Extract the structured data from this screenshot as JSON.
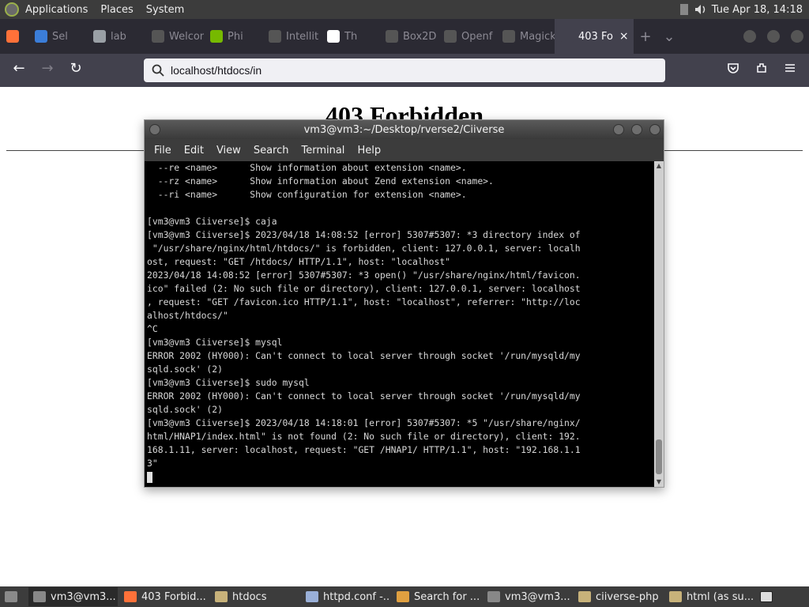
{
  "panel": {
    "menus": [
      "Applications",
      "Places",
      "System"
    ],
    "clock": "Tue Apr 18, 14:18"
  },
  "tabs": [
    {
      "label": "",
      "icon": "firefox-icon",
      "color": "#ff7139"
    },
    {
      "label": "Sel",
      "icon": "globe-icon",
      "color": "#3b7dd8"
    },
    {
      "label": "lab",
      "icon": "computer-icon",
      "color": "#9aa0a6"
    },
    {
      "label": "Welcom",
      "icon": "page-icon",
      "color": "#555555"
    },
    {
      "label": "Phi",
      "icon": "nvidia-icon",
      "color": "#76b900"
    },
    {
      "label": "Intellit",
      "icon": "page-icon",
      "color": "#555555"
    },
    {
      "label": "Th",
      "icon": "document-icon",
      "color": "#ffffff"
    },
    {
      "label": "Box2D",
      "icon": "page-icon",
      "color": "#555555"
    },
    {
      "label": "Openf",
      "icon": "page-icon",
      "color": "#555555"
    },
    {
      "label": "Magick",
      "icon": "page-icon",
      "color": "#555555"
    },
    {
      "label": "403 Fo",
      "icon": "page-icon",
      "color": "#42414d",
      "active": true
    }
  ],
  "tab_close": "×",
  "url": "localhost/htdocs/in",
  "page": {
    "title": "403 Forbidden"
  },
  "terminal": {
    "title": "vm3@vm3:~/Desktop/rverse2/Ciiverse",
    "menu": [
      "File",
      "Edit",
      "View",
      "Search",
      "Terminal",
      "Help"
    ],
    "lines": [
      "  --re <name>      Show information about extension <name>.",
      "  --rz <name>      Show information about Zend extension <name>.",
      "  --ri <name>      Show configuration for extension <name>.",
      "",
      "[vm3@vm3 Ciiverse]$ caja",
      "[vm3@vm3 Ciiverse]$ 2023/04/18 14:08:52 [error] 5307#5307: *3 directory index of",
      " \"/usr/share/nginx/html/htdocs/\" is forbidden, client: 127.0.0.1, server: localh",
      "ost, request: \"GET /htdocs/ HTTP/1.1\", host: \"localhost\"",
      "2023/04/18 14:08:52 [error] 5307#5307: *3 open() \"/usr/share/nginx/html/favicon.",
      "ico\" failed (2: No such file or directory), client: 127.0.0.1, server: localhost",
      ", request: \"GET /favicon.ico HTTP/1.1\", host: \"localhost\", referrer: \"http://loc",
      "alhost/htdocs/\"",
      "^C",
      "[vm3@vm3 Ciiverse]$ mysql",
      "ERROR 2002 (HY000): Can't connect to local server through socket '/run/mysqld/my",
      "sqld.sock' (2)",
      "[vm3@vm3 Ciiverse]$ sudo mysql",
      "ERROR 2002 (HY000): Can't connect to local server through socket '/run/mysqld/my",
      "sqld.sock' (2)",
      "[vm3@vm3 Ciiverse]$ 2023/04/18 14:18:01 [error] 5307#5307: *5 \"/usr/share/nginx/",
      "html/HNAP1/index.html\" is not found (2: No such file or directory), client: 192.",
      "168.1.11, server: localhost, request: \"GET /HNAP1/ HTTP/1.1\", host: \"192.168.1.1",
      "3\""
    ]
  },
  "taskbar": [
    {
      "label": "vm3@vm3...",
      "icon": "terminal-icon",
      "color": "#888888",
      "active": true
    },
    {
      "label": "403 Forbid...",
      "icon": "firefox-icon",
      "color": "#ff7139"
    },
    {
      "label": "htdocs",
      "icon": "folder-icon",
      "color": "#c8b27a"
    },
    {
      "label": "httpd.conf -...",
      "icon": "text-editor-icon",
      "color": "#9ab0d8"
    },
    {
      "label": "Search for ...",
      "icon": "search-tool-icon",
      "color": "#e0a040"
    },
    {
      "label": "vm3@vm3...",
      "icon": "terminal-icon",
      "color": "#888888"
    },
    {
      "label": "ciiverse-php",
      "icon": "folder-icon",
      "color": "#c8b27a"
    },
    {
      "label": "html (as su...",
      "icon": "folder-icon",
      "color": "#c8b27a"
    }
  ]
}
